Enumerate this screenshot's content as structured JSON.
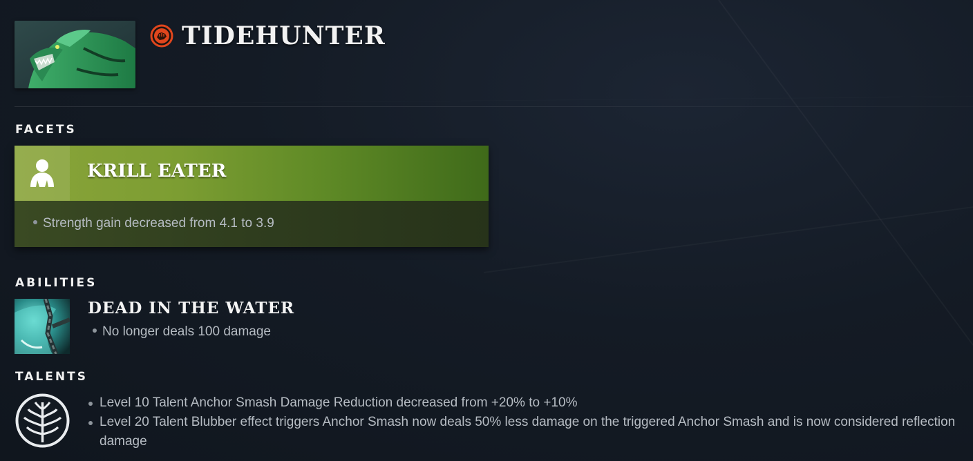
{
  "hero": {
    "name": "TIDEHUNTER",
    "portrait_icon": "tidehunter-portrait",
    "attribute_icon": "strength-attribute-icon"
  },
  "facets": {
    "title": "FACETS",
    "items": [
      {
        "name": "KRILL EATER",
        "icon": "person-silhouette-icon",
        "notes": [
          "Strength gain decreased from 4.1 to 3.9"
        ]
      }
    ]
  },
  "abilities": {
    "title": "ABILITIES",
    "items": [
      {
        "name": "DEAD IN THE WATER",
        "icon": "anchor-chain-ability-icon",
        "notes": [
          "No longer deals 100 damage"
        ]
      }
    ]
  },
  "talents": {
    "title": "TALENTS",
    "icon": "talent-tree-icon",
    "notes": [
      "Level 10 Talent Anchor Smash Damage Reduction decreased from +20% to +10%",
      "Level 20 Talent Blubber effect triggers Anchor Smash now deals 50% less damage on the triggered Anchor Smash and is now considered reflection damage"
    ]
  },
  "colors": {
    "background": "#141b25",
    "facet_green": "#7c9d32",
    "strength_red": "#e0461d",
    "text_muted": "#b6bcc3"
  }
}
